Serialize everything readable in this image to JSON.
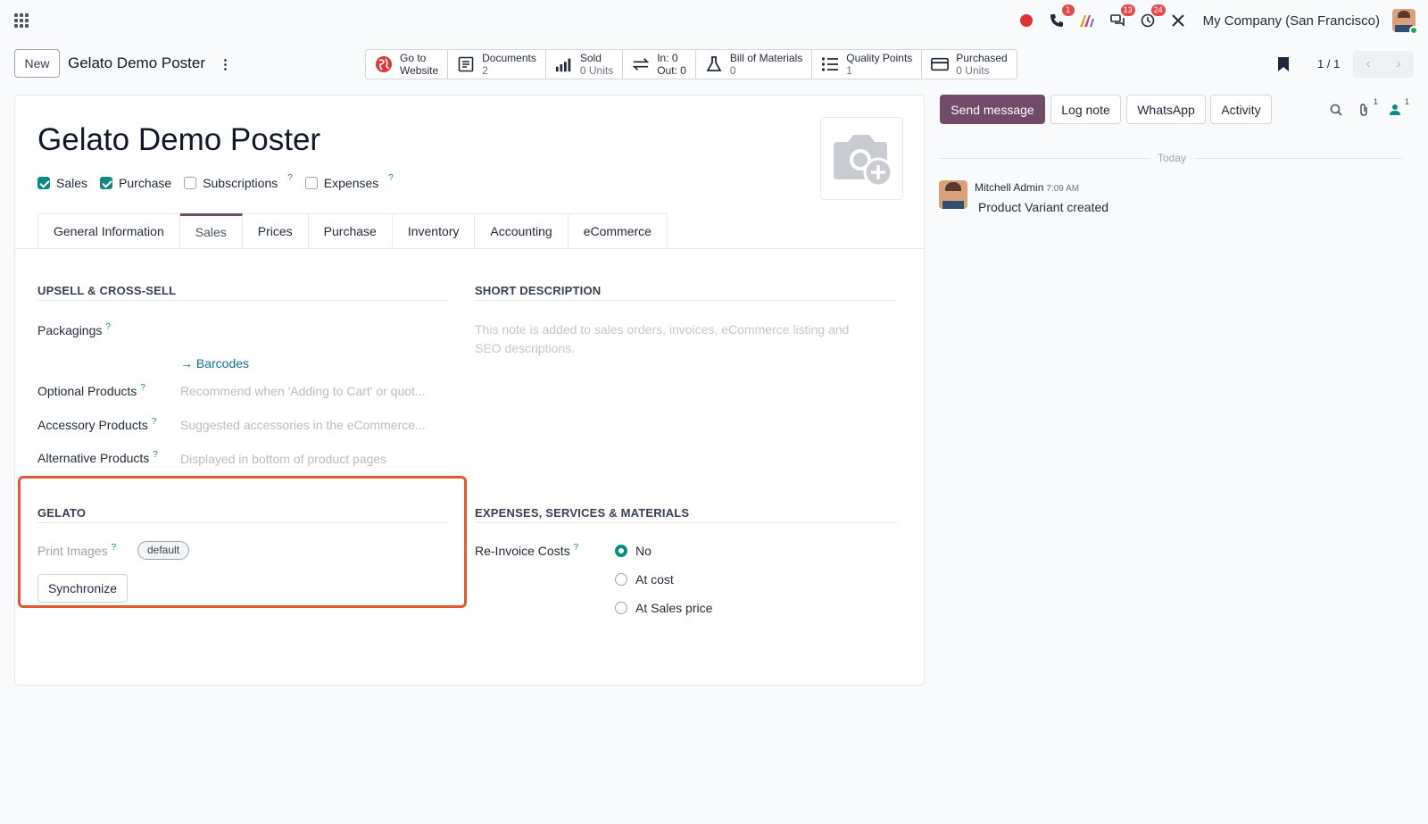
{
  "systray": {
    "phone_badge": "1",
    "discuss_badge": "13",
    "activity_badge": "24",
    "company": "My Company (San Francisco)"
  },
  "control": {
    "new_label": "New",
    "record_title": "Gelato Demo Poster",
    "pager_value": "1 / 1"
  },
  "smart_buttons": [
    {
      "label": "Go to",
      "value": "Website",
      "icon": "globe-icon"
    },
    {
      "label": "Documents",
      "value": "2",
      "icon": "document-icon"
    },
    {
      "label": "Sold",
      "value": "0 Units",
      "icon": "bar-chart-icon"
    },
    {
      "label": "In: 0",
      "value": "Out: 0",
      "icon": "exchange-icon"
    },
    {
      "label": "Bill of Materials",
      "value": "0",
      "icon": "flask-icon"
    },
    {
      "label": "Quality Points",
      "value": "1",
      "icon": "list-icon"
    },
    {
      "label": "Purchased",
      "value": "0 Units",
      "icon": "credit-card-icon"
    }
  ],
  "form": {
    "product_name": "Gelato Demo Poster",
    "checkboxes": [
      {
        "label": "Sales",
        "checked": true
      },
      {
        "label": "Purchase",
        "checked": true
      },
      {
        "label": "Subscriptions",
        "checked": false,
        "help": "?"
      },
      {
        "label": "Expenses",
        "checked": false,
        "help": "?"
      }
    ],
    "tabs": [
      "General Information",
      "Sales",
      "Prices",
      "Purchase",
      "Inventory",
      "Accounting",
      "eCommerce"
    ],
    "active_tab": "Sales",
    "upsell": {
      "title": "UPSELL & CROSS-SELL",
      "packagings_label": "Packagings",
      "barcodes_link": "Barcodes",
      "optional_label": "Optional Products",
      "optional_placeholder": "Recommend when 'Adding to Cart' or quot...",
      "accessory_label": "Accessory Products",
      "accessory_placeholder": "Suggested accessories in the eCommerce...",
      "alternative_label": "Alternative Products",
      "alternative_placeholder": "Displayed in bottom of product pages"
    },
    "short_description": {
      "title": "SHORT DESCRIPTION",
      "placeholder": "This note is added to sales orders, invoices, eCommerce listing and SEO descriptions."
    },
    "gelato": {
      "title": "GELATO",
      "print_images_label": "Print Images",
      "print_images_tag": "default",
      "sync_label": "Synchronize"
    },
    "expenses": {
      "title": "EXPENSES, SERVICES & MATERIALS",
      "reinvoice_label": "Re-Invoice Costs",
      "options": [
        "No",
        "At cost",
        "At Sales price"
      ],
      "selected": "No"
    }
  },
  "chatter": {
    "send_message": "Send message",
    "log_note": "Log note",
    "whatsapp": "WhatsApp",
    "activity": "Activity",
    "attachments_count": "1",
    "followers_count": "1",
    "day_label": "Today",
    "author": "Mitchell Admin",
    "time": "7:09 AM",
    "body": "Product Variant created"
  },
  "colors": {
    "brand": "#714b67",
    "accent": "#0f8a83",
    "highlight": "#e05a33",
    "badge": "#e5484d"
  }
}
